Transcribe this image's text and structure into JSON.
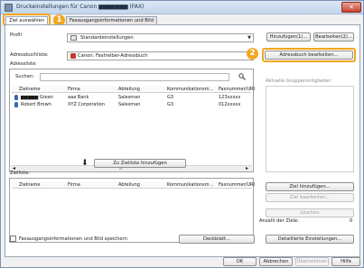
{
  "window": {
    "title": "Druckeinstellungen für Canon ▆▆▆▆▆▆▆ (FAX)",
    "close_glyph": "✕"
  },
  "tabs": [
    {
      "label": "Ziel auswählen",
      "active": true
    },
    {
      "label": "Faxausgangsinformationen und Bild",
      "active": false
    }
  ],
  "callouts": [
    "1",
    "2"
  ],
  "profile": {
    "label": "Profil",
    "value": "Standardeinstellungen",
    "add_button": "Hinzufügen(1)...",
    "edit_button": "Bearbeiten(2)..."
  },
  "addressbook": {
    "label": "Adressbuchliste:",
    "value": "Canon: Faxtreiber-Adressbuch",
    "edit_button": "Adressbuch bearbeiten..."
  },
  "address_list": {
    "label": "Adressliste:",
    "search_label": "Suchen:",
    "search_value": "",
    "columns": [
      "Zielname",
      "Firma",
      "Abteilung",
      "Kommunikationsm...",
      "Faxnummer/URI"
    ],
    "rows": [
      [
        "▆▆▆▆▆ Green",
        "aaa Bank",
        "Salesman",
        "G3",
        "123xxxxx"
      ],
      [
        "Robert Brown",
        "XYZ Corporation",
        "Salesman",
        "G3",
        "012xxxxx"
      ]
    ],
    "scroll_left": "◂",
    "scroll_mid": "III",
    "scroll_right": "▸"
  },
  "group_members_label": "Aktuelle Gruppenmitglieder:",
  "add_to_destinations_button": "Zu Zielliste hinzufügen",
  "down_arrow": "⬇",
  "destination_list": {
    "label": "Zielliste:",
    "columns": [
      "Zielname",
      "Firma",
      "Abteilung",
      "Kommunikationsm...",
      "Faxnummer/URI"
    ]
  },
  "side_buttons": {
    "add_destination": "Ziel hinzufügen...",
    "edit_destination": "Ziel bearbeiten...",
    "delete": "Löschen"
  },
  "destination_count_label": "Anzahl der Ziele:",
  "destination_count": "0",
  "save_checkbox_label": "Faxausgangsinformationen und Bild speichern",
  "cover_sheet_button": "Deckblatt...",
  "detailed_settings_button": "Detaillierte Einstellungen...",
  "footer_buttons": {
    "ok": "OK",
    "cancel": "Abbrechen",
    "apply": "Übernehmen",
    "help": "Hilfe"
  }
}
